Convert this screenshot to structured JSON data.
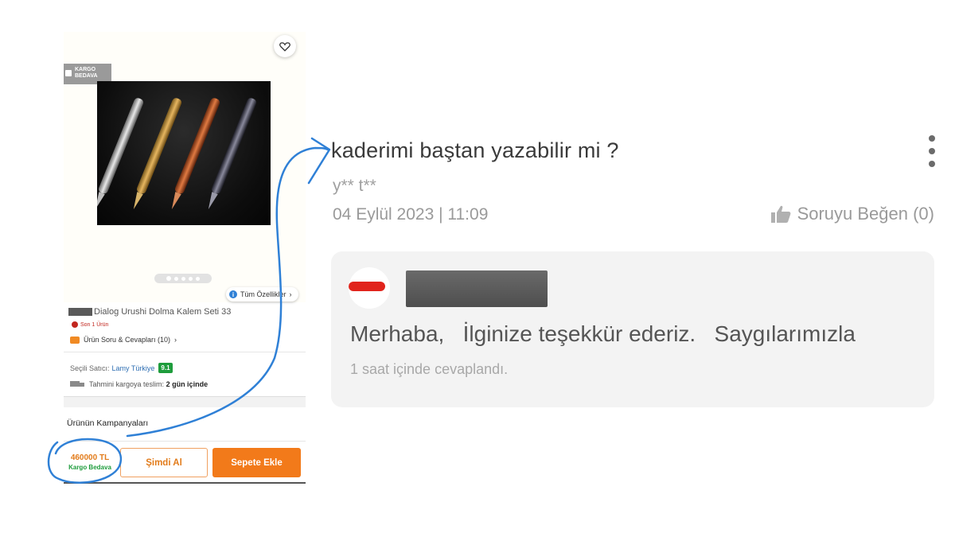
{
  "product": {
    "badge": "KARGO BEDAVA",
    "badge_line1": "KARGO",
    "badge_line2": "BEDAVA",
    "specs_link": "Tüm Özellikler",
    "title": "Dialog Urushi Dolma Kalem Seti 33",
    "stock_label": "Son 1 Ürün",
    "qa_link": "Ürün Soru & Cevapları (10)",
    "seller_label": "Seçili Satıcı:",
    "seller_name": "Lamy Türkiye",
    "seller_score": "9.1",
    "shipping_label": "Tahmini kargoya teslim:",
    "shipping_value": "2 gün içinde",
    "campaigns_title": "Ürünün Kampanyaları",
    "price": "460000 TL",
    "price_note": "Kargo Bedava",
    "buy_now": "Şimdi Al",
    "add_to_cart": "Sepete Ekle",
    "gallery_dots": 5,
    "gallery_active_index": 0
  },
  "question": {
    "text": "kaderimi baştan yazabilir mi ?",
    "asker": "y** t**",
    "date": "04 Eylül 2023 | 11:09",
    "like_label": "Soruyu Beğen (0)",
    "answer": "Merhaba,   İlginize teşekkür ederiz.   Saygılarımızla",
    "answer_time": "1 saat içinde cevaplandı."
  },
  "colors": {
    "accent_orange": "#f27a1a",
    "success_green": "#1e9c3c",
    "annotation_blue": "#2f80d6",
    "redaction_red": "#e1241c"
  },
  "icons": [
    "heart-icon",
    "cargo-box-icon",
    "info-icon",
    "chevron-right-icon",
    "clock-icon",
    "chat-bubble-icon",
    "truck-icon",
    "more-vertical-icon",
    "thumbs-up-icon"
  ]
}
